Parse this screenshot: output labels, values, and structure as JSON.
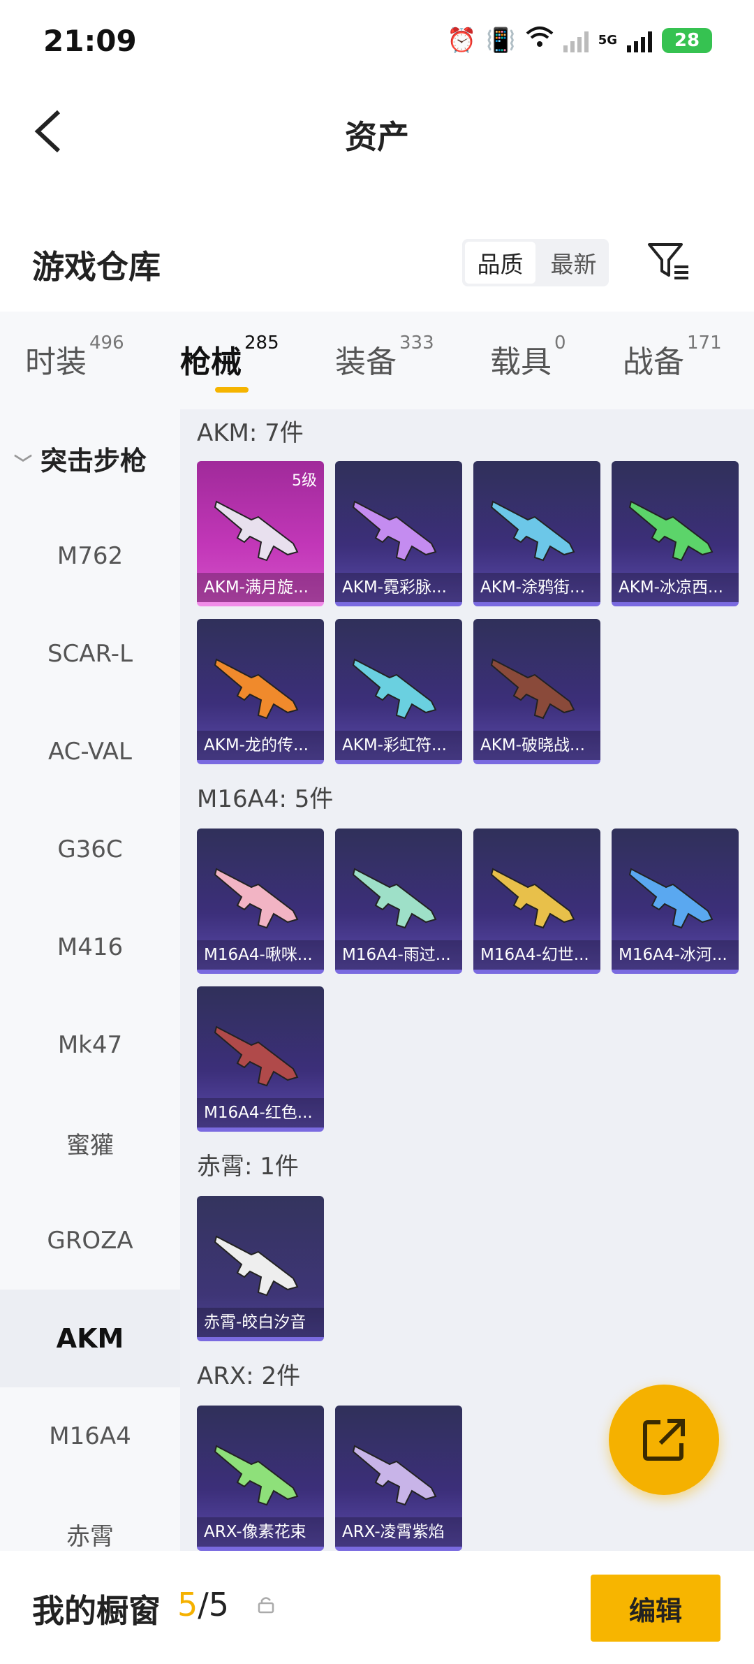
{
  "status_bar": {
    "time": "21:09",
    "battery": "28",
    "network": "5G"
  },
  "nav": {
    "title": "资产"
  },
  "warehouse": {
    "title": "游戏仓库",
    "sort_options": [
      "品质",
      "最新"
    ],
    "active_sort": "品质"
  },
  "tabs": [
    {
      "label": "时装",
      "count": "496"
    },
    {
      "label": "枪械",
      "count": "285",
      "active": true
    },
    {
      "label": "装备",
      "count": "333"
    },
    {
      "label": "载具",
      "count": "0"
    },
    {
      "label": "战备",
      "count": "171"
    }
  ],
  "sidebar": {
    "group": "突击步枪",
    "items": [
      "M762",
      "SCAR-L",
      "AC-VAL",
      "G36C",
      "M416",
      "Mk47",
      "蜜獾",
      "GROZA",
      "AKM",
      "M16A4",
      "赤霄"
    ],
    "active": "AKM"
  },
  "groups": [
    {
      "title": "AKM: 7件",
      "items": [
        {
          "label": "AKM-满月旋...",
          "level": "5级",
          "quality": "gold",
          "color": "#e8e0ee"
        },
        {
          "label": "AKM-霓彩脉...",
          "quality": "purple",
          "color": "#c48cf0"
        },
        {
          "label": "AKM-涂鸦街...",
          "quality": "purple",
          "color": "#6cc7e8"
        },
        {
          "label": "AKM-冰凉西...",
          "quality": "purple",
          "color": "#5cd46a"
        },
        {
          "label": "AKM-龙的传...",
          "quality": "purple",
          "color": "#f08a2c"
        },
        {
          "label": "AKM-彩虹符...",
          "quality": "purple",
          "color": "#6ad0e0"
        },
        {
          "label": "AKM-破晓战...",
          "quality": "purple",
          "color": "#8a4a3a"
        }
      ]
    },
    {
      "title": "M16A4: 5件",
      "items": [
        {
          "label": "M16A4-啾咪...",
          "quality": "purple",
          "color": "#f2b4c4"
        },
        {
          "label": "M16A4-雨过...",
          "quality": "purple",
          "color": "#9ee0c8"
        },
        {
          "label": "M16A4-幻世...",
          "quality": "purple",
          "color": "#e8c04a"
        },
        {
          "label": "M16A4-冰河...",
          "quality": "purple",
          "color": "#5aa8f0"
        },
        {
          "label": "M16A4-红色...",
          "quality": "purple",
          "color": "#b04a4a"
        }
      ]
    },
    {
      "title": "赤霄: 1件",
      "items": [
        {
          "label": "赤霄-皎白汐音",
          "quality": "white-q",
          "color": "#eeeeee"
        }
      ]
    },
    {
      "title": "ARX: 2件",
      "items": [
        {
          "label": "ARX-像素花束",
          "quality": "purple",
          "color": "#8ee07a"
        },
        {
          "label": "ARX-凌霄紫焰",
          "quality": "purple",
          "color": "#c8b4e8"
        }
      ]
    }
  ],
  "bottom_bar": {
    "showcase_label": "我的橱窗",
    "showcase_current": "5",
    "showcase_total": "/5",
    "edit_label": "编辑"
  },
  "colors": {
    "accent": "#f5b100",
    "purple_card": "#3c2f7a",
    "gold_card": "#c237b8"
  }
}
